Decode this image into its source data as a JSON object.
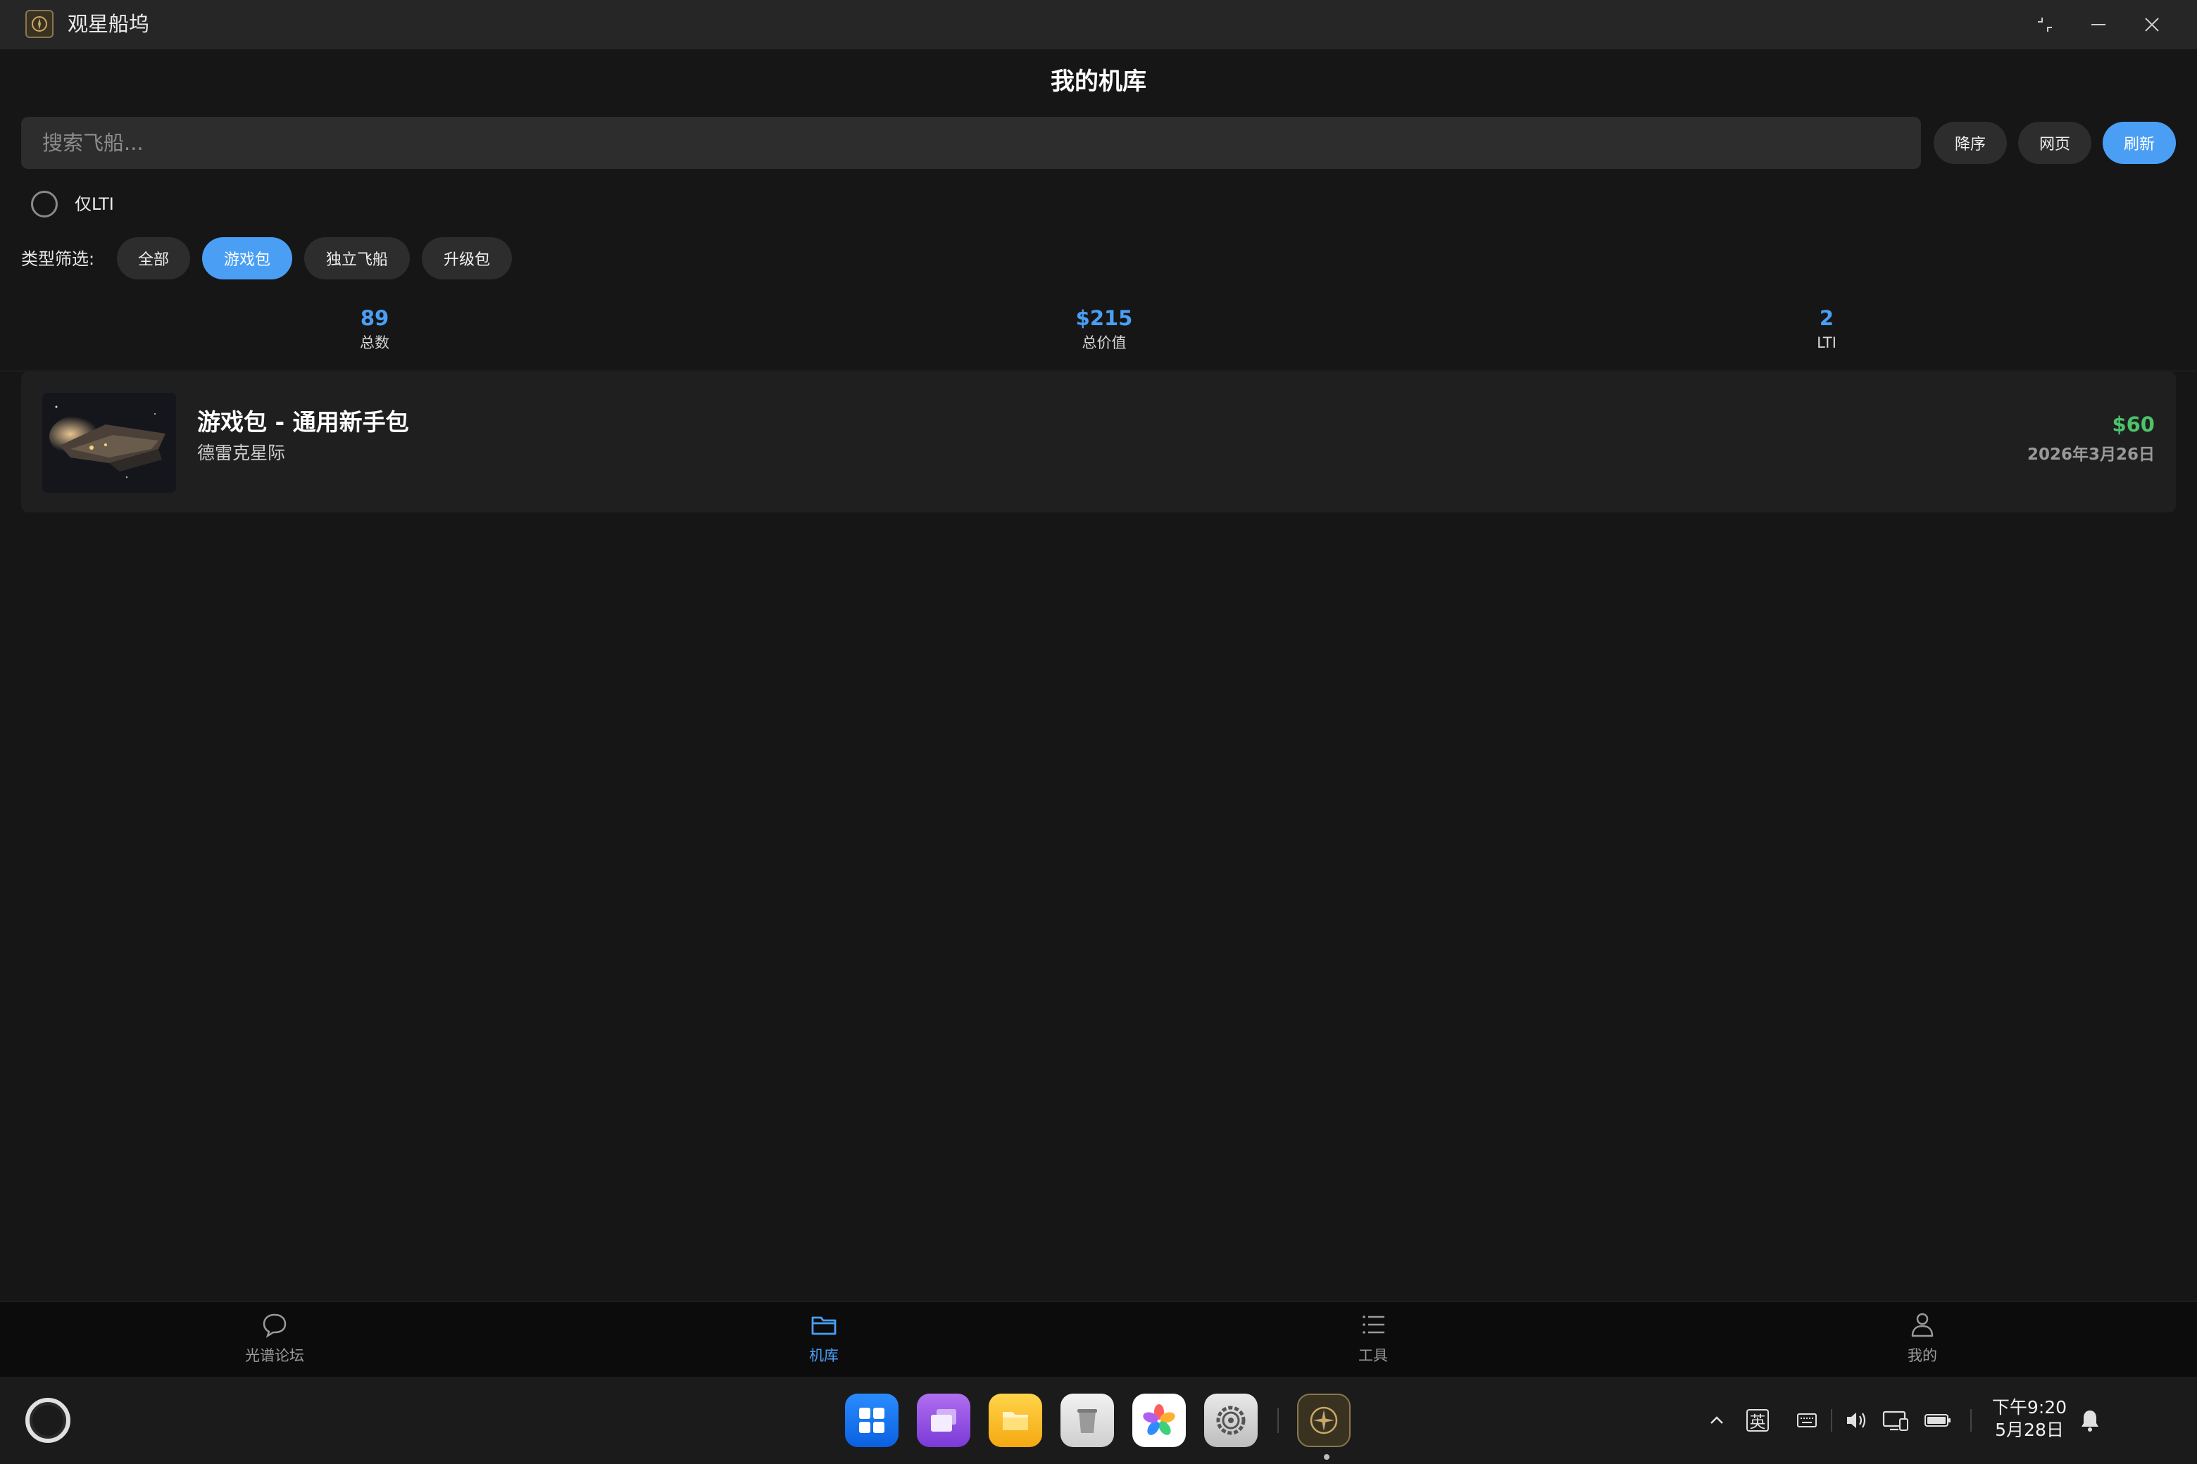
{
  "window": {
    "title": "观星船坞",
    "icon": "app-emblem-icon",
    "controls": [
      "restore-icon",
      "minimize-icon",
      "close-icon"
    ]
  },
  "header": {
    "title": "我的机库",
    "search_placeholder": "搜索飞船...",
    "buttons": {
      "sort": "降序",
      "web": "网页",
      "refresh": "刷新"
    }
  },
  "lti_filter": {
    "label": "仅LTI",
    "checked": false
  },
  "type_filter": {
    "label": "类型筛选:",
    "options": [
      "全部",
      "游戏包",
      "独立飞船",
      "升级包"
    ],
    "selected": "游戏包"
  },
  "stats": [
    {
      "value": "89",
      "label": "总数"
    },
    {
      "value": "$215",
      "label": "总价值"
    },
    {
      "value": "2",
      "label": "LTI"
    }
  ],
  "items": [
    {
      "title": "游戏包 - 通用新手包",
      "subtitle": "德雷克星际",
      "price": "$60",
      "date": "2026年3月26日"
    }
  ],
  "bottom_nav": {
    "items": [
      {
        "label": "光谱论坛",
        "icon": "chat-bubble-icon"
      },
      {
        "label": "机库",
        "icon": "folder-icon"
      },
      {
        "label": "工具",
        "icon": "list-icon"
      },
      {
        "label": "我的",
        "icon": "person-icon"
      }
    ],
    "active": "机库"
  },
  "taskbar": {
    "dock_apps": [
      "app-center-icon",
      "multitask-icon",
      "files-icon",
      "trash-icon",
      "gallery-icon",
      "settings-icon",
      "app-emblem-icon"
    ],
    "tray": {
      "ime": "英",
      "clock_time": "下午9:20",
      "clock_date": "5月28日"
    }
  },
  "colors": {
    "accent": "#4a9ff5",
    "price": "#4cc36a",
    "background": "#161616",
    "surface": "#2d2d2d"
  }
}
